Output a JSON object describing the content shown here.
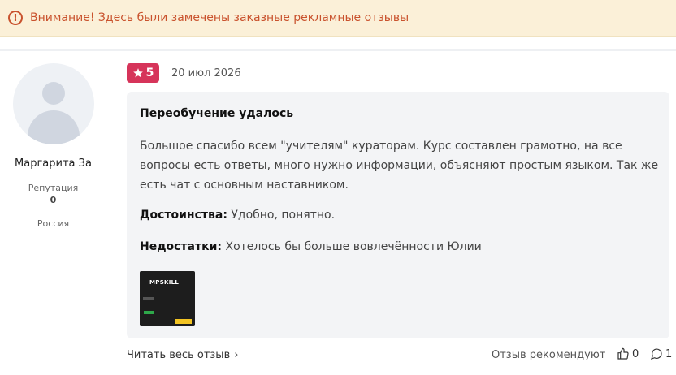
{
  "warning": {
    "icon": "alert-circle-icon",
    "text": "Внимание! Здесь были замечены заказные рекламные отзывы",
    "color": "#c9522d",
    "background": "#fbf0d8"
  },
  "author": {
    "name": "Маргарита За",
    "reputation_label": "Репутация",
    "reputation_value": "0",
    "country": "Россия"
  },
  "review": {
    "rating": "5",
    "rating_color": "#d6345a",
    "date": "20 июл 2026",
    "title": "Переобучение удалось",
    "body": "Большое спасибо всем \"учителям\" кураторам. Курс составлен грамотно, на все вопросы есть ответы, много нужно информации, объясняют простым языком. Так же есть чат с основным наставником.",
    "pros_label": "Достоинства:",
    "pros_text": " Удобно, понятно.",
    "cons_label": "Недостатки:",
    "cons_text": " Хотелось бы больше вовлечённости Юлии",
    "image": {
      "logo_text": "MPSKILL"
    }
  },
  "footer": {
    "read_full": "Читать весь отзыв",
    "recommend_label": "Отзыв рекомендуют",
    "likes": "0",
    "comments": "1"
  }
}
